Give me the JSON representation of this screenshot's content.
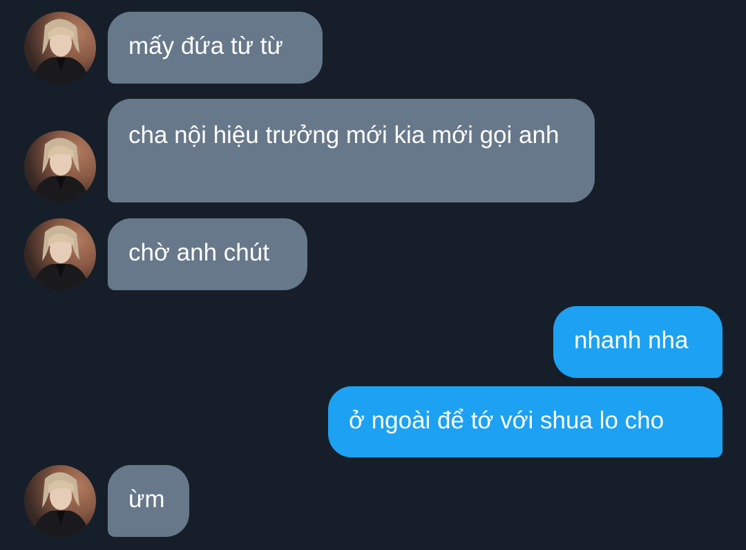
{
  "messages": [
    {
      "side": "incoming",
      "text": "mấy đứa từ từ",
      "avatar_icon": "profile-photo-icon"
    },
    {
      "side": "incoming",
      "text": "cha nội hiệu trưởng mới kia mới gọi anh",
      "avatar_icon": "profile-photo-icon"
    },
    {
      "side": "incoming",
      "text": "chờ anh chút",
      "avatar_icon": "profile-photo-icon"
    },
    {
      "side": "outgoing",
      "text": "nhanh nha"
    },
    {
      "side": "outgoing",
      "text": "ở ngoài để tớ với shua lo cho"
    },
    {
      "side": "incoming",
      "text": "ừm",
      "avatar_icon": "profile-photo-icon"
    }
  ],
  "colors": {
    "background": "#161e29",
    "incoming_bubble": "#67788a",
    "outgoing_bubble": "#1da1f2",
    "text": "#ffffff"
  }
}
